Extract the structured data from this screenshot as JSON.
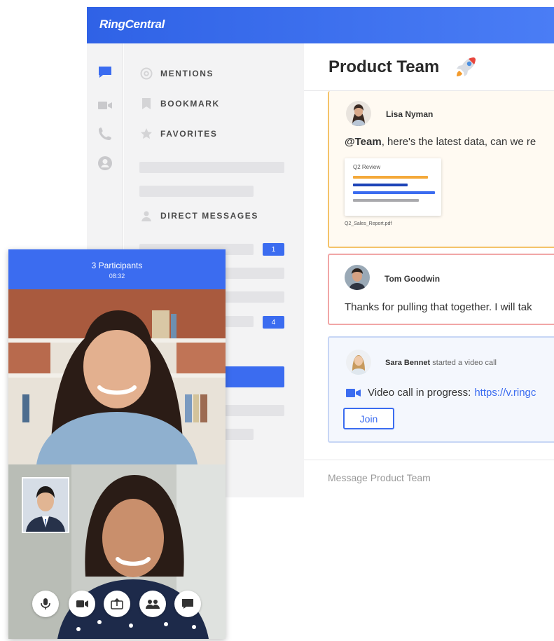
{
  "app": {
    "brand": "RingCentral",
    "rail": {
      "icons": [
        "message-icon",
        "video-icon",
        "phone-icon",
        "contacts-icon"
      ]
    },
    "sidebar": {
      "mentions": "MENTIONS",
      "bookmark": "BOOKMARK",
      "favorites": "FAVORITES",
      "direct_messages": "DIRECT MESSAGES",
      "counts": [
        "1",
        "4"
      ]
    },
    "conversation": {
      "title": "Product Team",
      "title_emoji": "rocket-icon",
      "messages": [
        {
          "author": "Lisa Nyman",
          "mention": "@Team",
          "text": ", here's the latest data, can we re",
          "attachment": {
            "title": "Q2 Review",
            "filename": "Q2_Sales_Report.pdf"
          }
        },
        {
          "author": "Tom Goodwin",
          "text": "Thanks for pulling that together. I will tak"
        },
        {
          "author": "Sara Bennet",
          "action": "started a video call",
          "text": "Video call in progress:",
          "link": "https://v.ringc",
          "join_label": "Join"
        }
      ],
      "composer_placeholder": "Message Product Team"
    }
  },
  "call": {
    "participants": "3 Participants",
    "timer": "08:32",
    "controls": [
      "microphone-icon",
      "camera-icon",
      "share-screen-icon",
      "participants-icon",
      "chat-icon"
    ]
  },
  "colors": {
    "accent": "#3b6cf0",
    "header_gradient_start": "#2f62e6",
    "header_gradient_end": "#4a7df5",
    "highlight_border": "#f4c36a",
    "alert_border": "#f1a6a6",
    "call_border": "#c7d6f5"
  }
}
